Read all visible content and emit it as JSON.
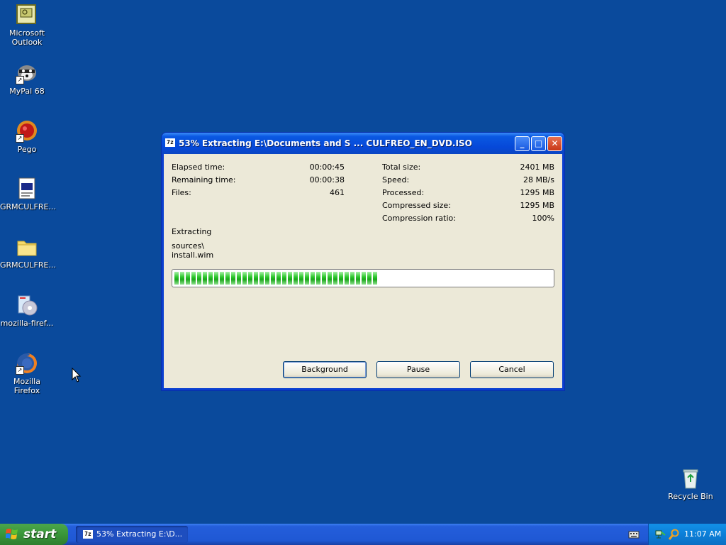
{
  "desktop": {
    "icons": [
      {
        "label": "Microsoft Outlook"
      },
      {
        "label": "MyPal 68"
      },
      {
        "label": "Pego"
      },
      {
        "label": "GRMCULFRE..."
      },
      {
        "label": "GRMCULFRE..."
      },
      {
        "label": "mozilla-firef..."
      },
      {
        "label": "Mozilla Firefox"
      },
      {
        "label": "Recycle Bin"
      }
    ]
  },
  "dialog": {
    "app_icon_text": "7z",
    "title": "53% Extracting E:\\Documents and S ... CULFREO_EN_DVD.ISO",
    "left_stats": [
      {
        "label": "Elapsed time:",
        "value": "00:00:45"
      },
      {
        "label": "Remaining time:",
        "value": "00:00:38"
      },
      {
        "label": "Files:",
        "value": "461"
      }
    ],
    "right_stats": [
      {
        "label": "Total size:",
        "value": "2401 MB"
      },
      {
        "label": "Speed:",
        "value": "28 MB/s"
      },
      {
        "label": "Processed:",
        "value": "1295 MB"
      },
      {
        "label": "Compressed size:",
        "value": "1295 MB"
      },
      {
        "label": "Compression ratio:",
        "value": "100%"
      }
    ],
    "status_label": "Extracting",
    "current_path": "sources\\",
    "current_file": "install.wim",
    "progress_fraction": 0.55,
    "buttons": {
      "background": "Background",
      "pause": "Pause",
      "cancel": "Cancel"
    }
  },
  "taskbar": {
    "start_label": "start",
    "task_label": "53% Extracting E:\\D...",
    "clock": "11:07 AM"
  },
  "colors": {
    "desktop_bg": "#0a4a9c",
    "titlebar": "#0a58e2",
    "progress_green": "#2ec82e",
    "dialog_bg": "#ece9d8"
  }
}
